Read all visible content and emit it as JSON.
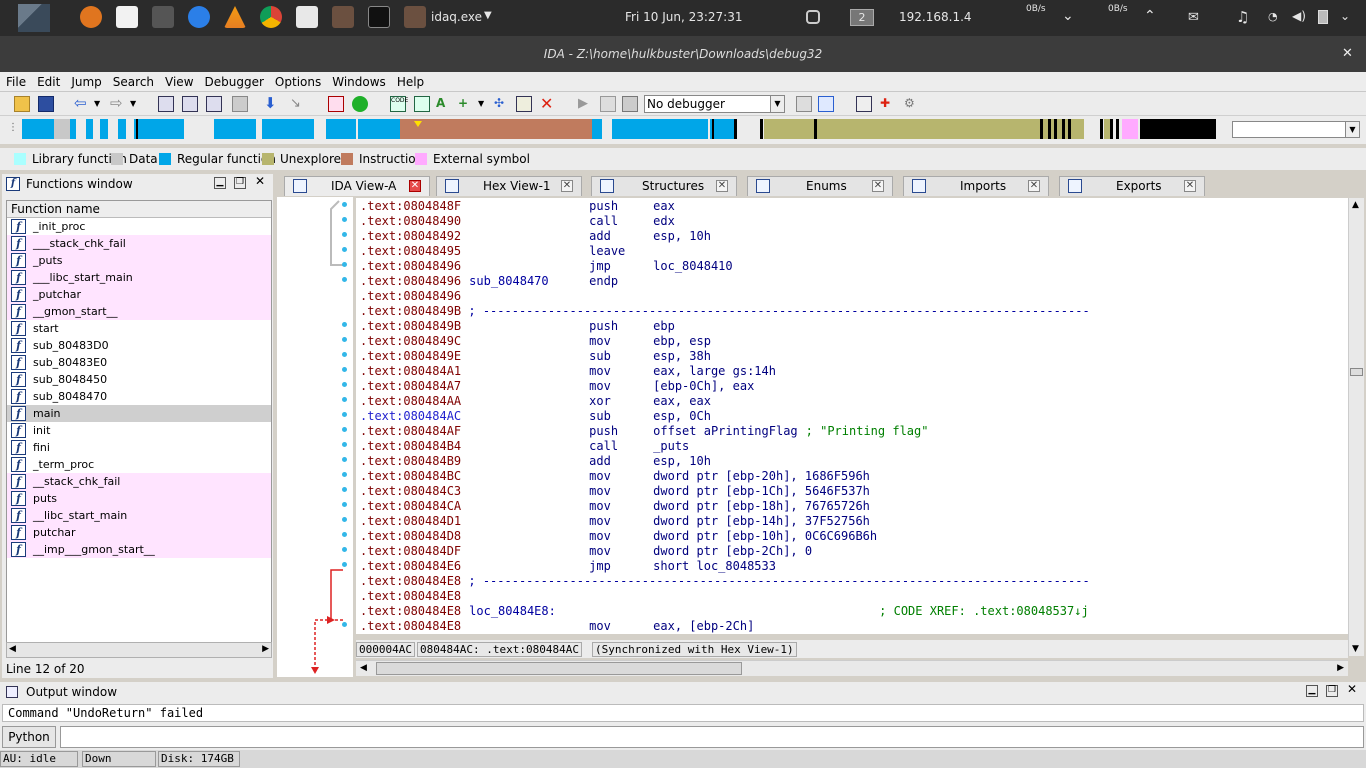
{
  "taskbar": {
    "active_app": "idaq.exe",
    "clock": "Fri 10 Jun, 23:27:31",
    "workspace": "2",
    "ip": "192.168.1.4",
    "net_down": "0B/s",
    "net_up": "0B/s"
  },
  "window": {
    "title": "IDA - Z:\\home\\hulkbuster\\Downloads\\debug32",
    "close": "✕"
  },
  "menu": [
    "File",
    "Edit",
    "Jump",
    "Search",
    "View",
    "Debugger",
    "Options",
    "Windows",
    "Help"
  ],
  "toolbar": {
    "debugger_select": "No debugger"
  },
  "legend": [
    {
      "label": "Library function",
      "color": "#aaffff"
    },
    {
      "label": "Data",
      "color": "#c8c8c8"
    },
    {
      "label": "Regular function",
      "color": "#00a6e8"
    },
    {
      "label": "Unexplored",
      "color": "#b7b56e"
    },
    {
      "label": "Instruction",
      "color": "#c07b5e"
    },
    {
      "label": "External symbol",
      "color": "#ffaaff"
    }
  ],
  "functions_window": {
    "title": "Functions window",
    "column": "Function name",
    "status": "Line 12 of 20",
    "items": [
      {
        "name": "_init_proc",
        "lib": false
      },
      {
        "name": "___stack_chk_fail",
        "lib": true
      },
      {
        "name": "_puts",
        "lib": true
      },
      {
        "name": "___libc_start_main",
        "lib": true
      },
      {
        "name": "_putchar",
        "lib": true
      },
      {
        "name": "__gmon_start__",
        "lib": true
      },
      {
        "name": "start",
        "lib": false
      },
      {
        "name": "sub_80483D0",
        "lib": false
      },
      {
        "name": "sub_80483E0",
        "lib": false
      },
      {
        "name": "sub_8048450",
        "lib": false
      },
      {
        "name": "sub_8048470",
        "lib": false
      },
      {
        "name": "main",
        "lib": false,
        "selected": true
      },
      {
        "name": "init",
        "lib": false
      },
      {
        "name": "fini",
        "lib": false
      },
      {
        "name": "_term_proc",
        "lib": false
      },
      {
        "name": "__stack_chk_fail",
        "lib": true
      },
      {
        "name": "puts",
        "lib": true
      },
      {
        "name": "__libc_start_main",
        "lib": true
      },
      {
        "name": "putchar",
        "lib": true
      },
      {
        "name": "__imp___gmon_start__",
        "lib": true
      }
    ]
  },
  "tabs": [
    "IDA View-A",
    "Hex View-1",
    "Structures",
    "Enums",
    "Imports",
    "Exports"
  ],
  "code": {
    "lines": [
      {
        "addr": ".text:0804848F",
        "mn": "push",
        "op": "eax"
      },
      {
        "addr": ".text:08048490",
        "mn": "call",
        "op": "edx"
      },
      {
        "addr": ".text:08048492",
        "mn": "add",
        "op": "esp, 10h"
      },
      {
        "addr": ".text:08048495",
        "mn": "leave",
        "op": ""
      },
      {
        "addr": ".text:08048496",
        "mn": "jmp",
        "op": "loc_8048410"
      },
      {
        "addr": ".text:08048496",
        "label": "sub_8048470",
        "mn": "endp",
        "op": ""
      },
      {
        "addr": ".text:08048496",
        "mn": "",
        "op": ""
      },
      {
        "addr": ".text:0804849B",
        "sep": true
      },
      {
        "addr": ".text:0804849B",
        "mn": "push",
        "op": "ebp"
      },
      {
        "addr": ".text:0804849C",
        "mn": "mov",
        "op": "ebp, esp"
      },
      {
        "addr": ".text:0804849E",
        "mn": "sub",
        "op": "esp, 38h"
      },
      {
        "addr": ".text:080484A1",
        "mn": "mov",
        "op": "eax, large gs:14h"
      },
      {
        "addr": ".text:080484A7",
        "mn": "mov",
        "op": "[ebp-0Ch], eax"
      },
      {
        "addr": ".text:080484AA",
        "mn": "xor",
        "op": "eax, eax"
      },
      {
        "addr": ".text:080484AC",
        "mn": "sub",
        "op": "esp, 0Ch",
        "hl": true
      },
      {
        "addr": ".text:080484AF",
        "mn": "push",
        "op": "offset aPrintingFlag",
        "cmt": "; \"Printing flag\""
      },
      {
        "addr": ".text:080484B4",
        "mn": "call",
        "op": "_puts"
      },
      {
        "addr": ".text:080484B9",
        "mn": "add",
        "op": "esp, 10h"
      },
      {
        "addr": ".text:080484BC",
        "mn": "mov",
        "op": "dword ptr [ebp-20h], 1686F596h"
      },
      {
        "addr": ".text:080484C3",
        "mn": "mov",
        "op": "dword ptr [ebp-1Ch], 5646F537h"
      },
      {
        "addr": ".text:080484CA",
        "mn": "mov",
        "op": "dword ptr [ebp-18h], 76765726h"
      },
      {
        "addr": ".text:080484D1",
        "mn": "mov",
        "op": "dword ptr [ebp-14h], 37F52756h"
      },
      {
        "addr": ".text:080484D8",
        "mn": "mov",
        "op": "dword ptr [ebp-10h], 0C6C696B6h"
      },
      {
        "addr": ".text:080484DF",
        "mn": "mov",
        "op": "dword ptr [ebp-2Ch], 0"
      },
      {
        "addr": ".text:080484E6",
        "mn": "jmp",
        "op": "short loc_8048533"
      },
      {
        "addr": ".text:080484E8",
        "sep": true
      },
      {
        "addr": ".text:080484E8",
        "mn": "",
        "op": ""
      },
      {
        "addr": ".text:080484E8",
        "label": "loc_80484E8:",
        "mn": "",
        "op": "",
        "cmt": "; CODE XREF: .text:08048537↓j"
      },
      {
        "addr": ".text:080484E8",
        "mn": "mov",
        "op": "eax, [ebp-2Ch]"
      }
    ]
  },
  "code_status": {
    "offset": "000004AC",
    "location": "080484AC: .text:080484AC",
    "sync": "(Synchronized with Hex View-1)"
  },
  "output": {
    "title": "Output window",
    "text": "Command \"UndoReturn\" failed",
    "python": "Python"
  },
  "statusbar": {
    "au": "AU:  idle",
    "dir": "Down",
    "disk": "Disk: 174GB"
  }
}
